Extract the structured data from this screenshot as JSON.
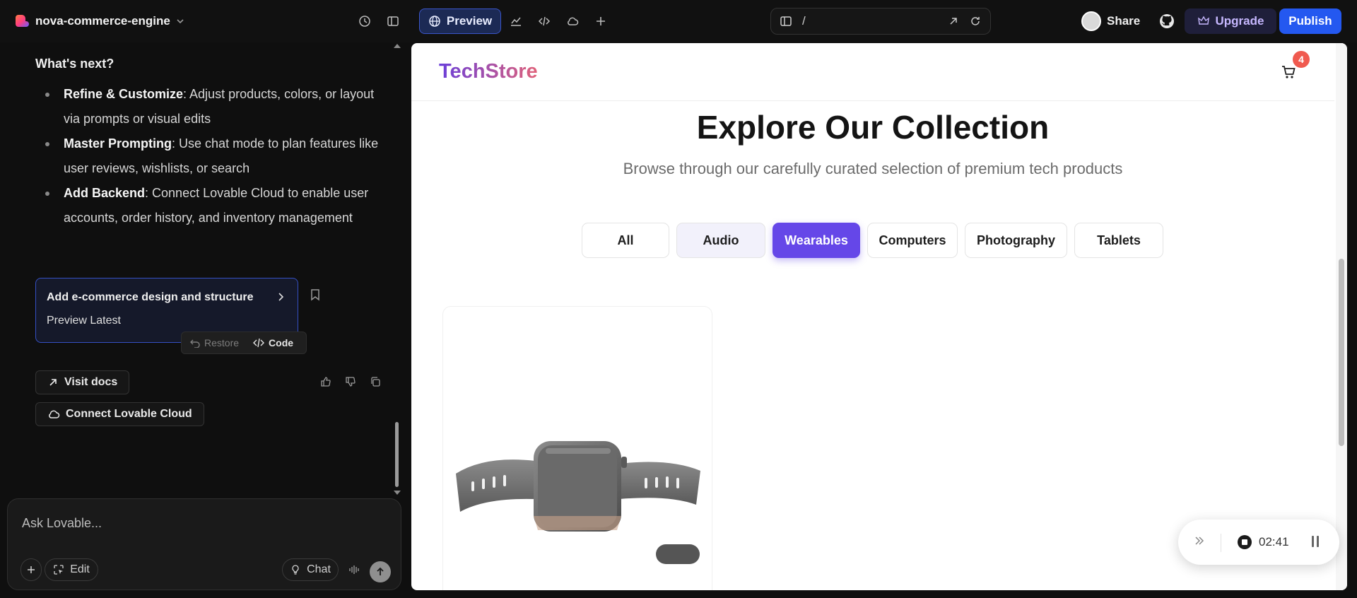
{
  "topbar": {
    "project_name": "nova-commerce-engine",
    "preview_label": "Preview",
    "url_path": "/",
    "share_label": "Share",
    "upgrade_label": "Upgrade",
    "publish_label": "Publish"
  },
  "chat": {
    "heading": "What's next?",
    "bullets": [
      {
        "bold": "Refine & Customize",
        "text": ": Adjust products, colors, or layout via prompts or visual edits"
      },
      {
        "bold": "Master Prompting",
        "text": ": Use chat mode to plan features like user reviews, wishlists, or search"
      },
      {
        "bold": "Add Backend",
        "text": ": Connect Lovable Cloud to enable user accounts, order history, and inventory management"
      }
    ],
    "card_title": "Add e-commerce design and structure",
    "card_subtitle": "Preview Latest",
    "restore_label": "Restore",
    "code_label": "Code",
    "visit_docs_label": "Visit docs",
    "connect_cloud_label": "Connect Lovable Cloud",
    "composer_placeholder": "Ask Lovable...",
    "edit_label": "Edit",
    "chat_label": "Chat"
  },
  "site": {
    "logo": "TechStore",
    "cart_count": "4",
    "hero_title": "Explore Our Collection",
    "hero_subtitle": "Browse through our carefully curated selection of premium tech products",
    "filters": [
      "All",
      "Audio",
      "Wearables",
      "Computers",
      "Photography",
      "Tablets"
    ],
    "active_filter": "Wearables"
  },
  "recorder": {
    "time": "02:41"
  },
  "colors": {
    "accent": "#6547e8",
    "publish": "#2458f0",
    "badge": "#f05a4f"
  }
}
